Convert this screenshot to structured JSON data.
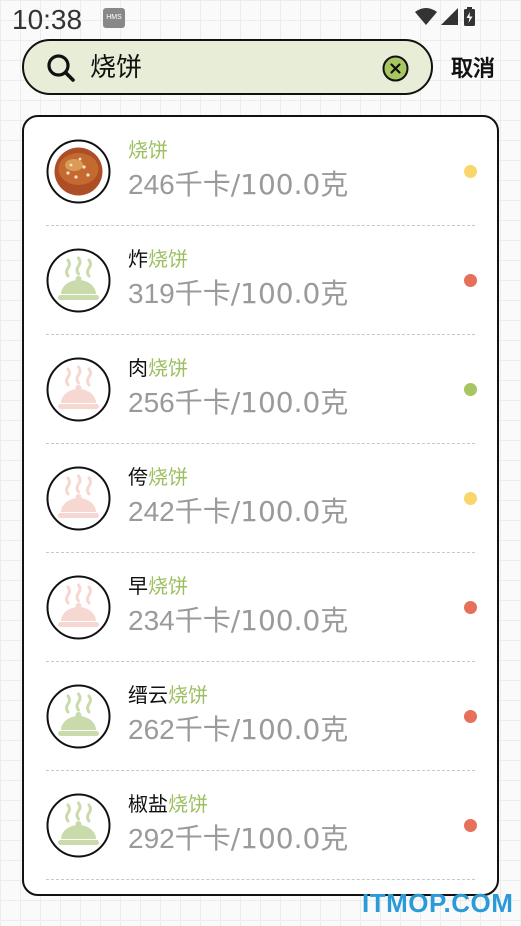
{
  "status_bar": {
    "time": "10:38",
    "badge": "HMS",
    "icons": [
      "wifi-icon",
      "signal-icon",
      "battery-icon"
    ]
  },
  "search": {
    "query": "烧饼",
    "cancel_label": "取消"
  },
  "colors": {
    "highlight": "#9cbf60",
    "yellow": "#f8d66b",
    "red": "#e6705a",
    "green": "#a7c561",
    "search_bg": "#e7edd7"
  },
  "items": [
    {
      "prefix": "",
      "match": "烧饼",
      "calories": "246",
      "unit": "千卡/100.0克",
      "level": "yellow",
      "thumb": "photo"
    },
    {
      "prefix": "炸",
      "match": "烧饼",
      "calories": "319",
      "unit": "千卡/100.0克",
      "level": "red",
      "thumb": "green-dish-icon"
    },
    {
      "prefix": "肉",
      "match": "烧饼",
      "calories": "256",
      "unit": "千卡/100.0克",
      "level": "green",
      "thumb": "pink-dish-icon"
    },
    {
      "prefix": "侉",
      "match": "烧饼",
      "calories": "242",
      "unit": "千卡/100.0克",
      "level": "yellow",
      "thumb": "pink-dish-icon"
    },
    {
      "prefix": "早",
      "match": "烧饼",
      "calories": "234",
      "unit": "千卡/100.0克",
      "level": "red",
      "thumb": "pink-dish-icon"
    },
    {
      "prefix": "缙云",
      "match": "烧饼",
      "calories": "262",
      "unit": "千卡/100.0克",
      "level": "red",
      "thumb": "green-dish-icon"
    },
    {
      "prefix": "椒盐",
      "match": "烧饼",
      "calories": "292",
      "unit": "千卡/100.0克",
      "level": "red",
      "thumb": "green-dish-icon"
    }
  ],
  "watermark": "ITMOP.COM"
}
